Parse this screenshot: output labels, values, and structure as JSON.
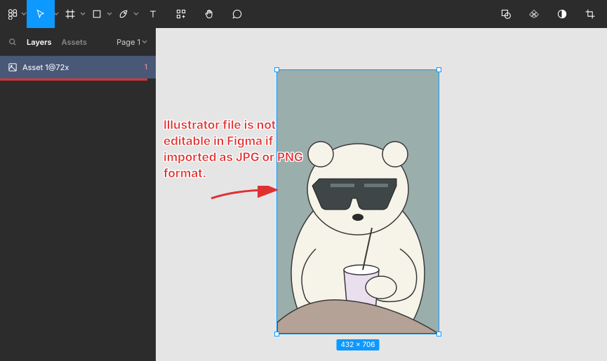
{
  "toolbar": {
    "main_menu": "figma-menu",
    "tools": [
      "move",
      "frame",
      "shape",
      "pen",
      "text",
      "components",
      "hand",
      "comment"
    ],
    "right_tools": [
      "mask",
      "boolean",
      "contrast",
      "crop"
    ]
  },
  "sidebar": {
    "tab_layers": "Layers",
    "tab_assets": "Assets",
    "page_label": "Page 1",
    "layer": {
      "name": "Asset 1@72x",
      "badge": "1"
    }
  },
  "selection": {
    "dimensions": "432 × 706"
  },
  "annotation": {
    "text": "Illustrator file is not editable in Figma if imported as JPG or PNG format."
  }
}
